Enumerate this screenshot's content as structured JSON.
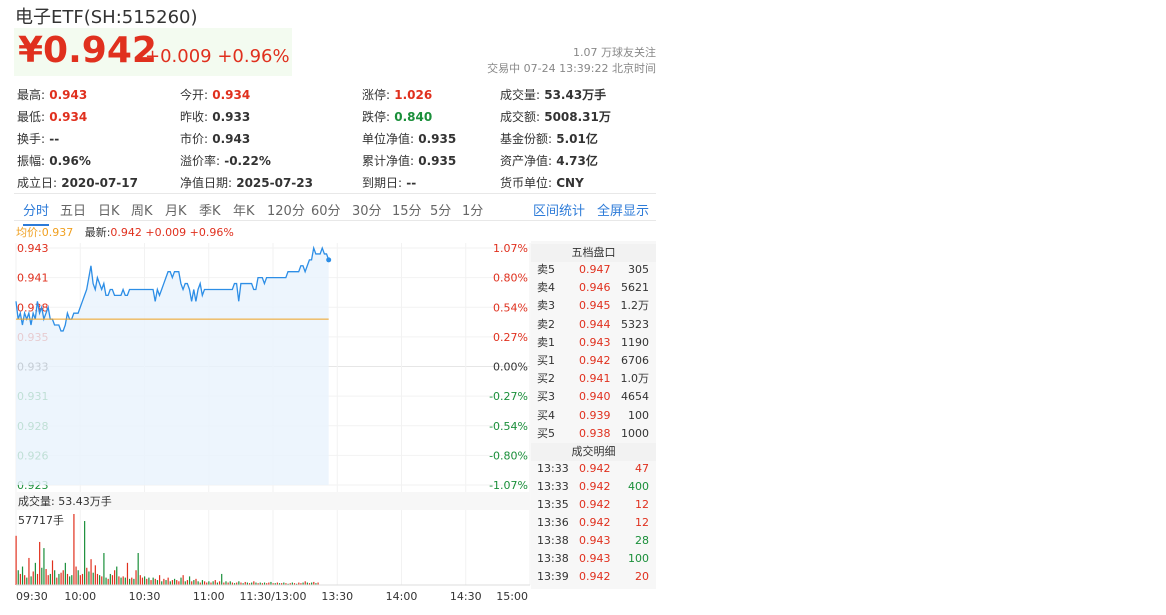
{
  "header": {
    "title": "电子ETF(SH:515260)",
    "price": "¥0.942",
    "change": "+0.009 +0.96%",
    "followers": "1.07 万球友关注",
    "trade_time": "交易中 07-24 13:39:22 北京时间"
  },
  "stats": [
    [
      {
        "k": "最高:",
        "v": "0.943",
        "c": "up"
      },
      {
        "k": "今开:",
        "v": "0.934",
        "c": "up"
      },
      {
        "k": "涨停:",
        "v": "1.026",
        "c": "up"
      },
      {
        "k": "成交量:",
        "v": "53.43万手",
        "c": ""
      }
    ],
    [
      {
        "k": "最低:",
        "v": "0.934",
        "c": "up"
      },
      {
        "k": "昨收:",
        "v": "0.933",
        "c": ""
      },
      {
        "k": "跌停:",
        "v": "0.840",
        "c": "down"
      },
      {
        "k": "成交额:",
        "v": "5008.31万",
        "c": ""
      }
    ],
    [
      {
        "k": "换手:",
        "v": "--",
        "c": ""
      },
      {
        "k": "市价:",
        "v": "0.943",
        "c": ""
      },
      {
        "k": "单位净值:",
        "v": "0.935",
        "c": ""
      },
      {
        "k": "基金份额:",
        "v": "5.01亿",
        "c": ""
      }
    ],
    [
      {
        "k": "振幅:",
        "v": "0.96%",
        "c": ""
      },
      {
        "k": "溢价率:",
        "v": "-0.22%",
        "c": ""
      },
      {
        "k": "累计净值:",
        "v": "0.935",
        "c": ""
      },
      {
        "k": "资产净值:",
        "v": "4.73亿",
        "c": ""
      }
    ],
    [
      {
        "k": "成立日:",
        "v": "2020-07-17",
        "c": ""
      },
      {
        "k": "净值日期:",
        "v": "2025-07-23",
        "c": ""
      },
      {
        "k": "到期日:",
        "v": "--",
        "c": ""
      },
      {
        "k": "货币单位:",
        "v": "CNY",
        "c": ""
      }
    ]
  ],
  "tabs": [
    "分时",
    "五日",
    "日K",
    "周K",
    "月K",
    "季K",
    "年K",
    "120分",
    "60分",
    "30分",
    "15分",
    "5分",
    "1分"
  ],
  "right_tabs": [
    "区间统计",
    "全屏显示"
  ],
  "legend": {
    "avg": "均价:0.937",
    "latest_label": "最新:",
    "latest": "0.942 +0.009 +0.96%"
  },
  "colors": {
    "up": "#e0301e",
    "down": "#1a8f3a",
    "line": "#2d8ee6",
    "avg": "#f0a020",
    "accent": "#2d7bd8"
  },
  "chart_data": {
    "type": "line",
    "price_ticks": [
      "0.943",
      "0.941",
      "0.938",
      "0.935",
      "0.933",
      "0.931",
      "0.928",
      "0.926",
      "0.923"
    ],
    "pct_ticks": [
      "1.07%",
      "0.80%",
      "0.54%",
      "0.27%",
      "0.00%",
      "-0.27%",
      "-0.54%",
      "-0.80%",
      "-1.07%"
    ],
    "ylim": [
      0.923,
      0.943
    ],
    "x_labels": [
      "09:30",
      "10:00",
      "10:30",
      "11:00",
      "11:30/13:00",
      "13:30",
      "14:00",
      "14:30",
      "15:00"
    ],
    "avg_price": 0.937,
    "prices": [
      0.9385,
      0.937,
      0.9375,
      0.9365,
      0.9375,
      0.937,
      0.9375,
      0.9365,
      0.9375,
      0.937,
      0.9385,
      0.9375,
      0.938,
      0.937,
      0.9375,
      0.938,
      0.937,
      0.937,
      0.9365,
      0.9365,
      0.9365,
      0.936,
      0.936,
      0.9365,
      0.9375,
      0.937,
      0.937,
      0.9375,
      0.9375,
      0.9375,
      0.938,
      0.9385,
      0.939,
      0.9395,
      0.9405,
      0.9415,
      0.94,
      0.9395,
      0.9405,
      0.94,
      0.9395,
      0.94,
      0.939,
      0.939,
      0.9395,
      0.9395,
      0.939,
      0.939,
      0.939,
      0.939,
      0.9395,
      0.939,
      0.939,
      0.9395,
      0.9395,
      0.9395,
      0.9395,
      0.9395,
      0.9395,
      0.9395,
      0.9395,
      0.9395,
      0.9395,
      0.9395,
      0.9395,
      0.9385,
      0.9395,
      0.939,
      0.9395,
      0.94,
      0.9405,
      0.941,
      0.941,
      0.9405,
      0.941,
      0.941,
      0.941,
      0.94,
      0.9395,
      0.94,
      0.94,
      0.9395,
      0.9385,
      0.9395,
      0.9385,
      0.9395,
      0.94,
      0.939,
      0.9395,
      0.9395,
      0.9395,
      0.9395,
      0.9395,
      0.9395,
      0.9395,
      0.9395,
      0.9395,
      0.9395,
      0.9395,
      0.9395,
      0.9395,
      0.9395,
      0.94,
      0.94,
      0.9385,
      0.94,
      0.94,
      0.94,
      0.94,
      0.94,
      0.94,
      0.9395,
      0.9395,
      0.9405,
      0.9405,
      0.9405,
      0.94,
      0.9405,
      0.9405,
      0.9405,
      0.9405,
      0.9405,
      0.9405,
      0.9405,
      0.9405,
      0.9405,
      0.9405,
      0.941,
      0.941,
      0.941,
      0.941,
      0.941,
      0.941,
      0.9415,
      0.9415,
      0.941,
      0.9415,
      0.942,
      0.942,
      0.943,
      0.9425,
      0.9425,
      0.9425,
      0.943,
      0.9425,
      0.9425,
      0.942
    ],
    "volume_label": "成交量: 53.43万手",
    "volume_max_label": "57717手",
    "volume_max": 57717,
    "volumes": [
      40000,
      12000,
      9000,
      15000,
      8000,
      6000,
      22000,
      7000,
      11000,
      18000,
      9000,
      35000,
      14000,
      30000,
      13000,
      8000,
      9000,
      20000,
      12000,
      6000,
      9000,
      10000,
      12000,
      18000,
      9000,
      7000,
      8000,
      57717,
      15000,
      12000,
      8000,
      9000,
      52000,
      14000,
      11000,
      21000,
      10000,
      16000,
      9000,
      8000,
      7000,
      26000,
      6000,
      5000,
      9000,
      8000,
      12000,
      15000,
      7000,
      6000,
      7000,
      6000,
      18000,
      5000,
      6000,
      5000,
      12000,
      26000,
      8000,
      6000,
      7000,
      5000,
      6000,
      4000,
      6000,
      5000,
      4000,
      8000,
      3000,
      5000,
      4000,
      6000,
      3000,
      4000,
      5000,
      4000,
      3000,
      6000,
      8000,
      3000,
      4000,
      7000,
      3000,
      4000,
      5000,
      3000,
      2000,
      4000,
      3000,
      2000,
      3000,
      2000,
      3000,
      4000,
      2000,
      3000,
      9000,
      2000,
      3000,
      2000,
      3000,
      2000,
      1500,
      2000,
      3000,
      2000,
      1500,
      2500,
      2000,
      1500,
      2000,
      3000,
      2000,
      1500,
      2000,
      1500,
      2000,
      1500,
      2000,
      2500,
      1500,
      1500,
      2000,
      1500,
      1500,
      2000,
      1500,
      1000,
      1500,
      2000,
      1500,
      1000,
      2000,
      1500,
      2000,
      3000,
      2000,
      1500,
      2000,
      2500,
      1500,
      2000
    ],
    "volume_colors": "rgrgrgrgrgrrggrrgrgrgrrgrggrrgrrgrgrgrrgrggrgrrgrgrgrgrgrgrrgrgrgrgrgrgrgrgrrgrgrgrgrgrgrrgrgrgrgrgrgrgrgrgrgrgrgrgrgrrgrgrgrgrgrgrgrrgrgrgrgrg",
    "series": [
      {
        "values": []
      }
    ]
  },
  "orderbook": {
    "title": "五档盘口",
    "sells": [
      {
        "label": "卖5",
        "price": "0.947",
        "vol": "305"
      },
      {
        "label": "卖4",
        "price": "0.946",
        "vol": "5621"
      },
      {
        "label": "卖3",
        "price": "0.945",
        "vol": "1.2万"
      },
      {
        "label": "卖2",
        "price": "0.944",
        "vol": "5323"
      },
      {
        "label": "卖1",
        "price": "0.943",
        "vol": "1190"
      }
    ],
    "buys": [
      {
        "label": "买1",
        "price": "0.942",
        "vol": "6706"
      },
      {
        "label": "买2",
        "price": "0.941",
        "vol": "1.0万"
      },
      {
        "label": "买3",
        "price": "0.940",
        "vol": "4654"
      },
      {
        "label": "买4",
        "price": "0.939",
        "vol": "100"
      },
      {
        "label": "买5",
        "price": "0.938",
        "vol": "1000"
      }
    ]
  },
  "trades": {
    "title": "成交明细",
    "rows": [
      {
        "time": "13:33",
        "price": "0.942",
        "vol": "47",
        "c": "up"
      },
      {
        "time": "13:33",
        "price": "0.942",
        "vol": "400",
        "c": "down"
      },
      {
        "time": "13:35",
        "price": "0.942",
        "vol": "12",
        "c": "up"
      },
      {
        "time": "13:36",
        "price": "0.942",
        "vol": "12",
        "c": "up"
      },
      {
        "time": "13:38",
        "price": "0.943",
        "vol": "28",
        "c": "down"
      },
      {
        "time": "13:38",
        "price": "0.943",
        "vol": "100",
        "c": "down"
      },
      {
        "time": "13:39",
        "price": "0.942",
        "vol": "20",
        "c": "up"
      }
    ]
  }
}
